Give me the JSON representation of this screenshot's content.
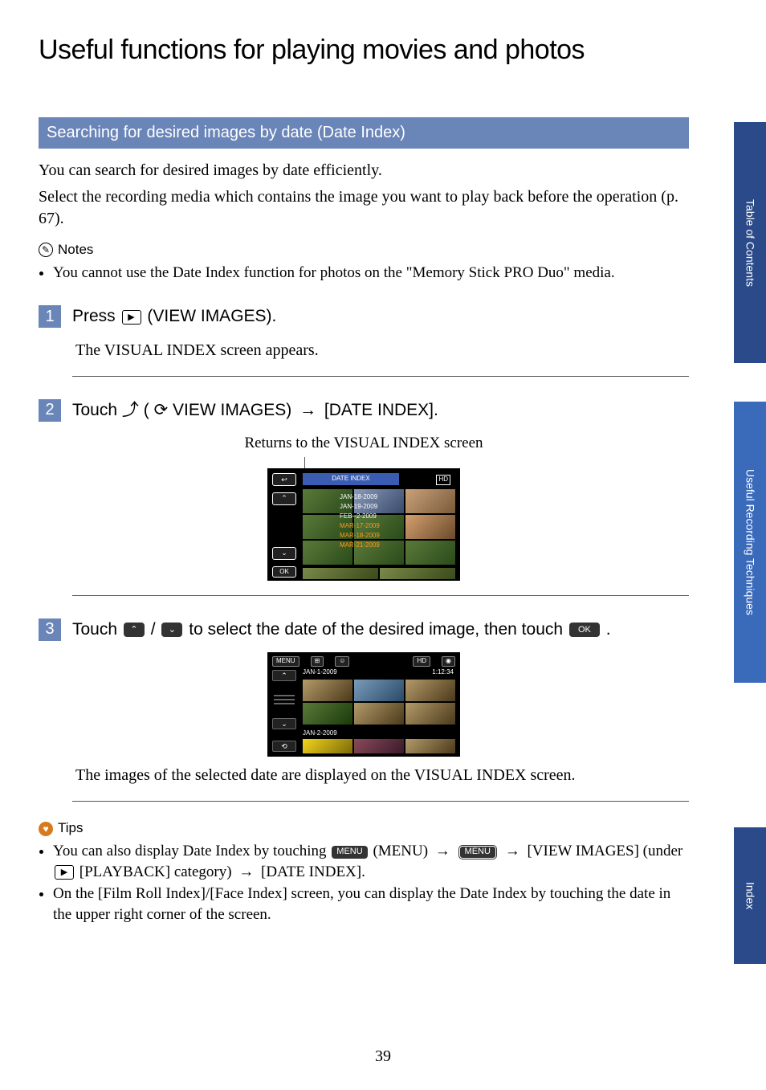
{
  "page_number": "39",
  "title": "Useful functions for playing movies and photos",
  "section_heading": "Searching for desired images by date (Date Index)",
  "intro_p1": "You can search for desired images by date efficiently.",
  "intro_p2": "Select the recording media which contains the image you want to play back before the operation (p. 67).",
  "notes_label": "Notes",
  "notes_items": [
    "You cannot use the Date Index function for photos on the \"Memory Stick PRO Duo\" media."
  ],
  "steps": {
    "s1": {
      "num": "1",
      "pre": "Press ",
      "post": " (VIEW IMAGES).",
      "desc": "The VISUAL INDEX screen appears."
    },
    "s2": {
      "num": "2",
      "pre": "Touch ",
      "mid": " (",
      "mid2": "VIEW IMAGES) ",
      "post": " [DATE INDEX].",
      "caption": "Returns to the VISUAL INDEX screen"
    },
    "s3": {
      "num": "3",
      "pre": "Touch ",
      "mid": "/",
      "mid2": " to select the date of the desired image, then touch ",
      "post": ".",
      "desc": "The images of the selected date are displayed on the VISUAL INDEX screen."
    }
  },
  "mock1": {
    "title_bar": "DATE INDEX",
    "hd": "HD",
    "back": "↩",
    "up": "⌃",
    "down": "⌄",
    "ok": "OK",
    "dates": [
      "JAN-18-2009",
      "JAN-19-2009",
      "FEB--2-2009",
      "MAR-17-2009",
      "MAR-18-2009",
      "MAR-21-2009"
    ]
  },
  "mock2": {
    "menu": "MENU",
    "hd": "HD",
    "time": "1:12:34",
    "d1": "JAN-1-2009",
    "d2": "JAN-2-2009",
    "up": "⌃",
    "down": "⌄"
  },
  "tips_label": "Tips",
  "tips": {
    "t1a": "You can also display Date Index by touching ",
    "t1b": " (MENU) ",
    "t1c": " ",
    "t1d": " ",
    "t1e": " [VIEW IMAGES] (under ",
    "t1f": " [PLAYBACK] category) ",
    "t1g": " [DATE INDEX].",
    "t2": "On the [Film Roll Index]/[Face Index] screen, you can display the Date Index by touching the date in the upper right corner of the screen."
  },
  "icons": {
    "menu": "MENU",
    "menu2": "MENU",
    "ok": "OK",
    "arrow": "→"
  },
  "tabs": {
    "toc": "Table of Contents",
    "tech": "Useful Recording Techniques",
    "index": "Index"
  }
}
